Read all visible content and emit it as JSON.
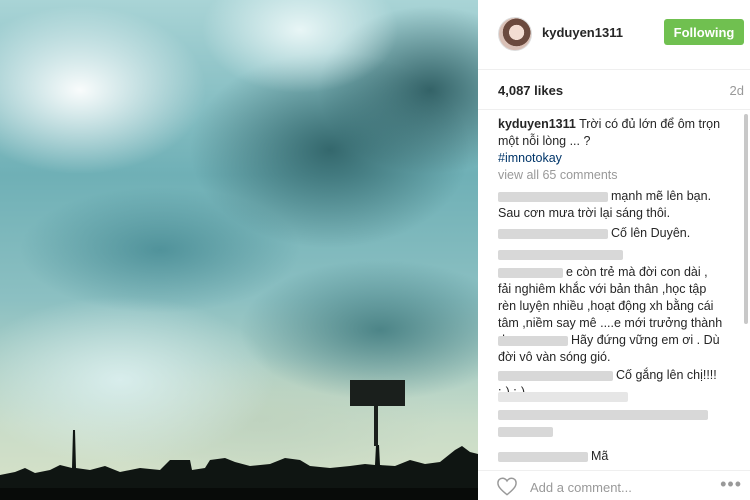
{
  "header": {
    "username": "kyduyen1311",
    "follow_label": "Following",
    "follow_color": "#70c050"
  },
  "stats": {
    "likes": "4,087 likes",
    "time_ago": "2d"
  },
  "caption": {
    "user": "kyduyen1311",
    "text": "Trời có đủ lớn để ôm trọn một nỗi lòng ... ? ",
    "hashtag": "#imnotokay"
  },
  "view_all_label": "view all 65 comments",
  "comments": [
    {
      "text": "mạnh mẽ lên bạn. Sau cơn mưa trời lại sáng thôi."
    },
    {
      "text": "Cố lên Duyên."
    },
    {
      "text": ""
    },
    {
      "text": "e còn trẻ mà đời con dài , fải nghiêm khắc với bản thân ,học tập rèn luyện nhiều ,hoạt động xh bằng cái tâm ,niềm say mê ....e mới trưởng thành dc."
    },
    {
      "text": "Hãy đứng vững em ơi . Dù đời vô vàn sóng gió."
    },
    {
      "text": "Cố gắng lên chị!!!! :-) :-)"
    },
    {
      "text": ""
    },
    {
      "text": ""
    },
    {
      "text": "Mã"
    }
  ],
  "footer": {
    "add_comment_placeholder": "Add a comment...",
    "more_label": "•••"
  },
  "icons": {
    "heart": "heart-icon",
    "more": "more-options-icon"
  }
}
